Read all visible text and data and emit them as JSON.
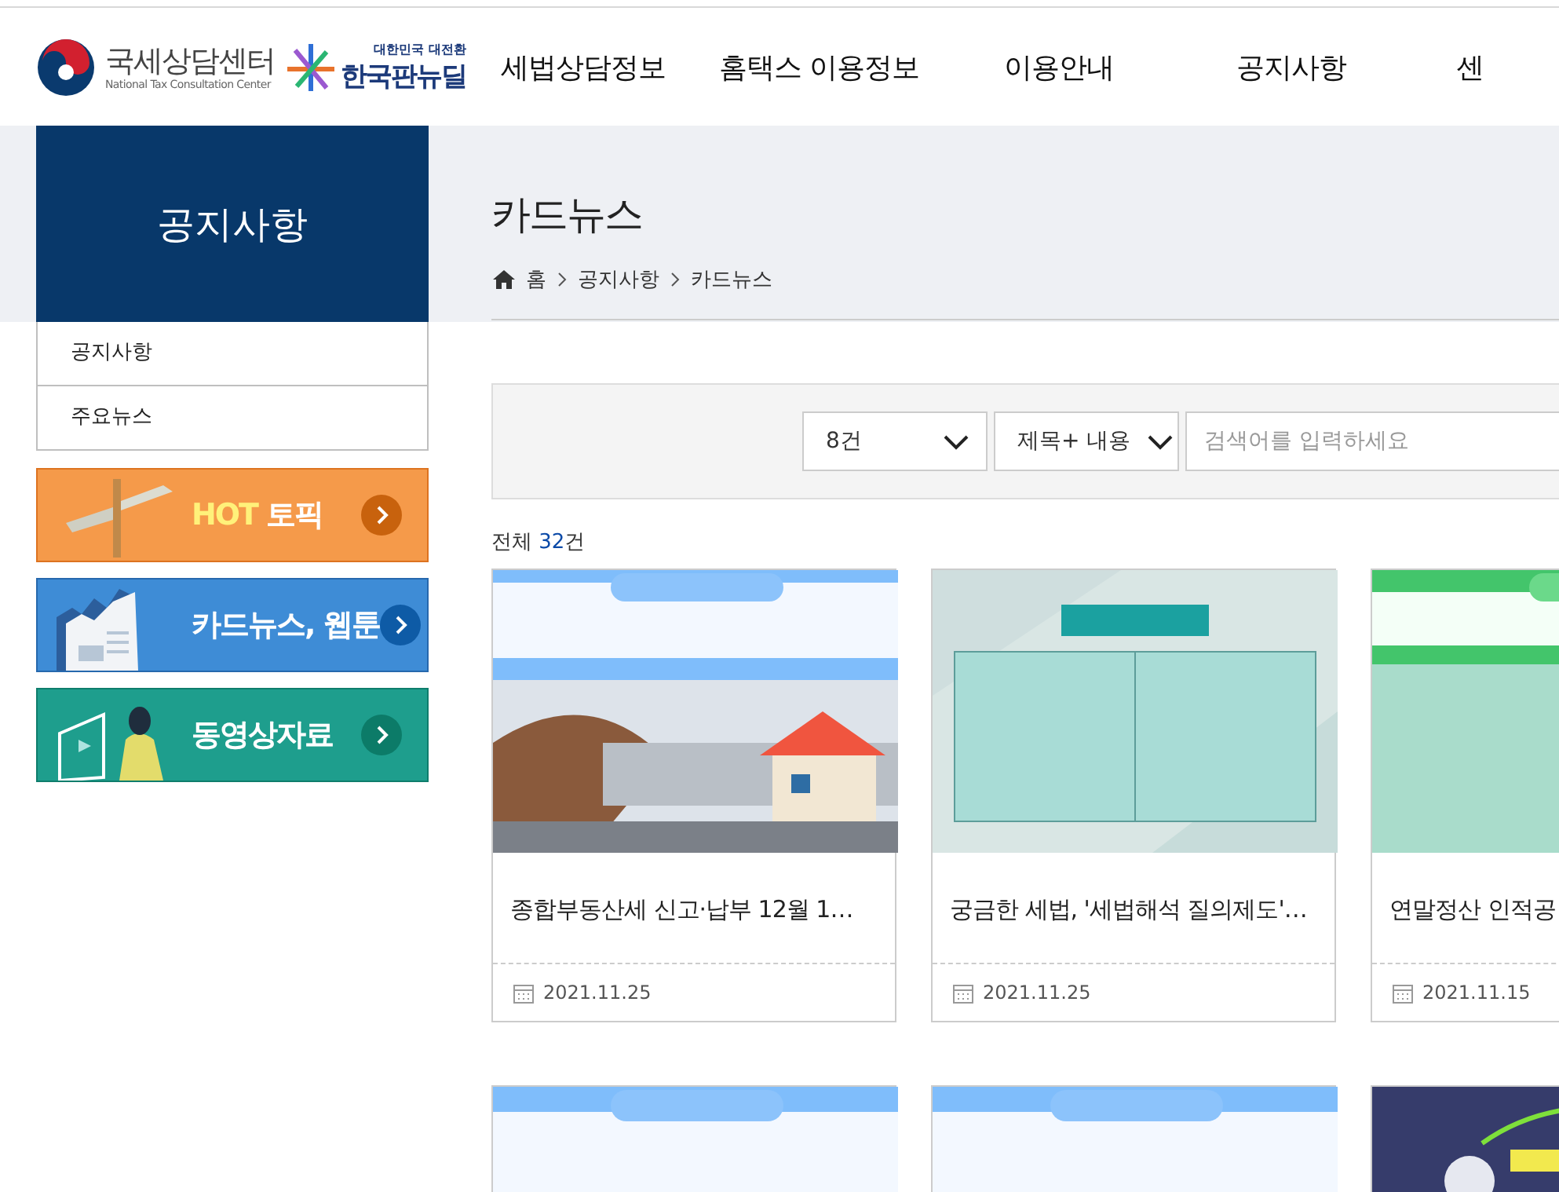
{
  "header": {
    "logo": {
      "name": "국세상담센터",
      "subtitle": "National Tax Consultation Center"
    },
    "campaign_logo": {
      "tagline": "대한민국 대전환",
      "name": "한국판뉴딜"
    },
    "nav": [
      {
        "label": "세법상담정보"
      },
      {
        "label": "홈택스 이용정보"
      },
      {
        "label": "이용안내"
      },
      {
        "label": "공지사항"
      },
      {
        "label": "센"
      }
    ]
  },
  "sidebar": {
    "title": "공지사항",
    "items": [
      {
        "label": "공지사항",
        "selected": false
      },
      {
        "label": "주요뉴스",
        "selected": false
      }
    ],
    "banners": [
      {
        "kind": "hot",
        "highlight": "HOT",
        "label": "토픽"
      },
      {
        "kind": "news",
        "label": "카드뉴스, 웹툰"
      },
      {
        "kind": "video",
        "label": "동영상자료"
      }
    ]
  },
  "page": {
    "title": "카드뉴스",
    "breadcrumb": [
      "홈",
      "공지사항",
      "카드뉴스"
    ]
  },
  "search": {
    "per_page": "8건",
    "field": "제목+ 내용",
    "placeholder": "검색어를 입력하세요"
  },
  "total": {
    "label": "전체",
    "count": "32",
    "unit": "건"
  },
  "cards": [
    {
      "image": {
        "kind": "picture"
      },
      "title": "종합부동산세 신고·납부 12월 1…",
      "date": "2021.11.25"
    },
    {
      "image": {
        "kind": "picture"
      },
      "title": "궁금한 세법, '세법해석 질의제도'…",
      "date": "2021.11.25"
    },
    {
      "image": {
        "kind": "picture"
      },
      "title": "연말정산 인적공",
      "date": "2021.11.15"
    },
    {
      "image": {
        "kind": "picture"
      }
    },
    {
      "image": {
        "kind": "picture"
      }
    },
    {
      "image": {
        "kind": "picture"
      }
    }
  ]
}
